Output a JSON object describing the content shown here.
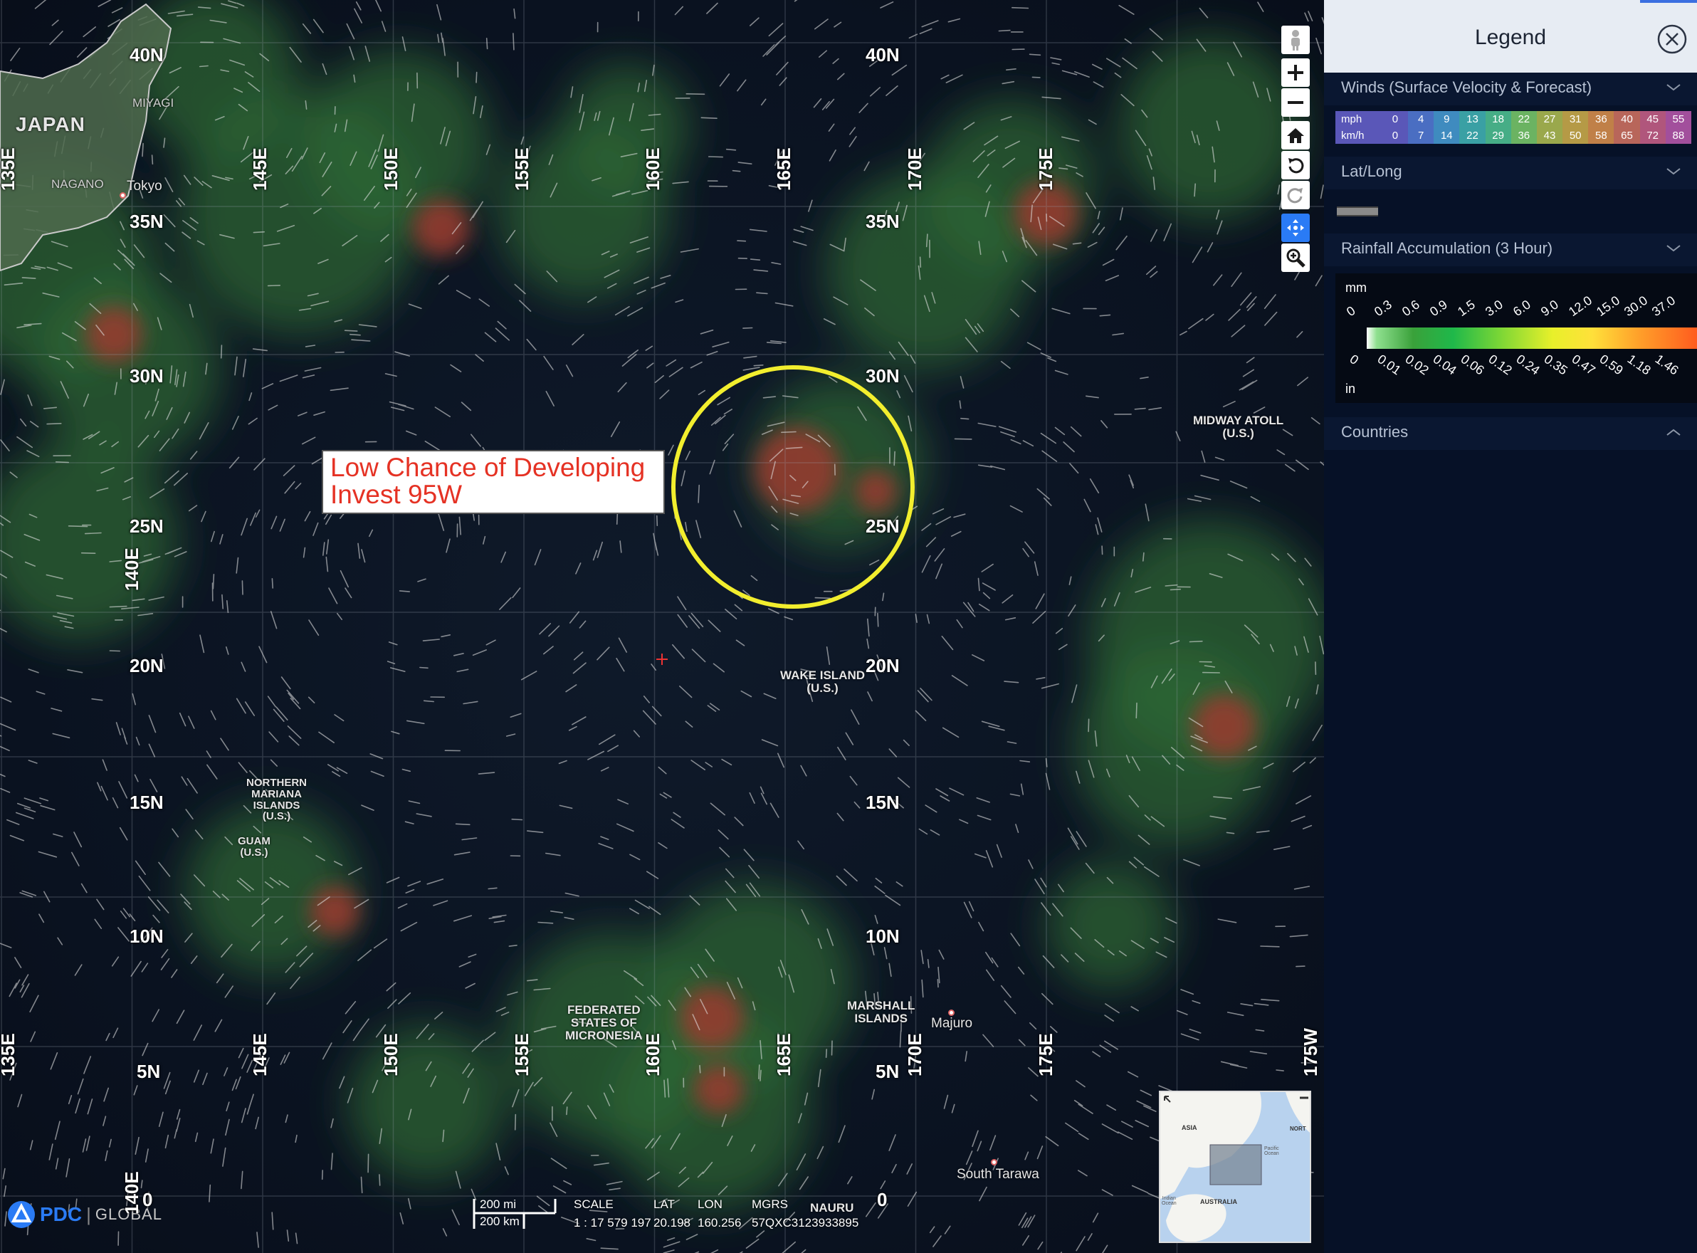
{
  "map": {
    "lat_labels": [
      "40N",
      "35N",
      "30N",
      "25N",
      "20N",
      "15N",
      "10N",
      "5N",
      "0"
    ],
    "lon_labels": [
      "135E",
      "140E",
      "145E",
      "150E",
      "155E",
      "160E",
      "165E",
      "170E",
      "175E",
      "175W"
    ],
    "places": {
      "japan": "JAPAN",
      "miyagi": "MIYAGI",
      "nagano": "NAGANO",
      "tokyo": "Tokyo",
      "midway": "MIDWAY ATOLL\n(U.S.)",
      "wake": "WAKE ISLAND\n(U.S.)",
      "nmi": "NORTHERN\nMARIANA\nISLANDS\n(U.S.)",
      "guam": "GUAM\n(U.S.)",
      "fsm": "FEDERATED\nSTATES OF\nMICRONESIA",
      "marshall": "MARSHALL\nISLANDS",
      "majuro": "Majuro",
      "tarawa": "South Tarawa",
      "nauru": "NAURU"
    },
    "callout": {
      "line1": "Low Chance of Developing",
      "line2": "Invest 95W"
    },
    "highlight_color": "#f2ee2e",
    "scale": {
      "mi": "200 mi",
      "km": "200 km"
    },
    "readouts": {
      "scale_label": "SCALE",
      "scale_value": "1 : 17 579 197",
      "lat_label": "LAT",
      "lat_value": "20.198",
      "lon_label": "LON",
      "lon_value": "160.256",
      "mgrs_label": "MGRS",
      "mgrs_value": "57QXC3123933895"
    },
    "logo": {
      "pdc": "PDC",
      "global": "GLOBAL"
    },
    "minimap": {
      "asia": "ASIA",
      "australia": "AUSTRALIA",
      "north": "NORT",
      "pacific": "Pacific\nOcean",
      "indian": "Indian\nOcean"
    }
  },
  "toolbar": {
    "icons": [
      "street-view-icon",
      "zoom-in-icon",
      "zoom-out-icon",
      "home-icon",
      "rotate-left-icon",
      "rotate-right-icon",
      "pan-icon",
      "zoom-box-icon"
    ]
  },
  "legend": {
    "title": "Legend",
    "sections": {
      "winds": "Winds (Surface Velocity & Forecast)",
      "latlong": "Lat/Long",
      "rain": "Rainfall Accumulation (3 Hour)",
      "countries": "Countries"
    },
    "wind_scale": {
      "mph_label": "mph",
      "kmh_label": "km/h",
      "mph": [
        "0",
        "4",
        "9",
        "13",
        "18",
        "22",
        "27",
        "31",
        "36",
        "40",
        "45",
        "55"
      ],
      "kmh": [
        "0",
        "7",
        "14",
        "22",
        "29",
        "36",
        "43",
        "50",
        "58",
        "65",
        "72",
        "88"
      ],
      "colors": [
        "#5a57b8",
        "#4a6ec2",
        "#3f8bbf",
        "#3aa0a4",
        "#46ad86",
        "#6bb362",
        "#9aa84c",
        "#b59a46",
        "#c08048",
        "#b8665a",
        "#b0567c",
        "#a24f9c"
      ]
    },
    "rain_scale": {
      "mm_label": "mm",
      "in_label": "in",
      "mm": [
        "0",
        "0.3",
        "0.6",
        "0.9",
        "1.5",
        "3.0",
        "6.0",
        "9.0",
        "12.0",
        "15.0",
        "30.0",
        "37.0"
      ],
      "in": [
        "0",
        "0.01",
        "0.02",
        "0.04",
        "0.06",
        "0.12",
        "0.24",
        "0.35",
        "0.47",
        "0.59",
        "1.18",
        "1.46"
      ]
    }
  }
}
